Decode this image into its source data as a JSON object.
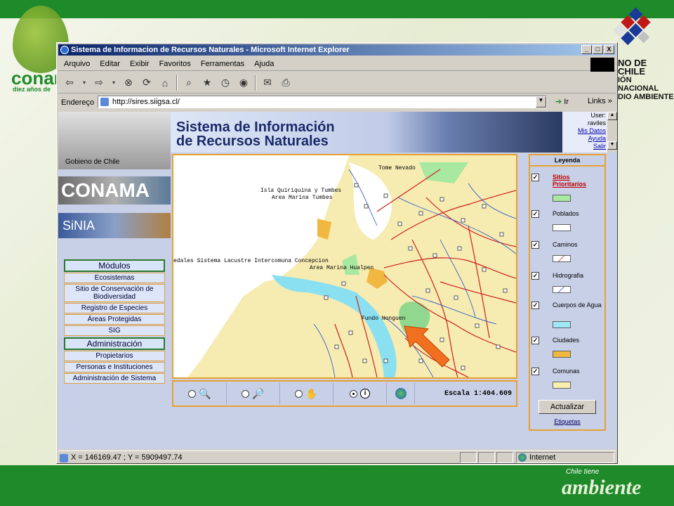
{
  "slide": {
    "conama_logo": "conam",
    "conama_sub": "diez años de",
    "gov_line1": "NO DE CHILE",
    "gov_line2": "IÓN NACIONAL",
    "gov_line3": "DIO AMBIENTE",
    "chile_tiene": "Chile tiene",
    "ambiente": "ambiente"
  },
  "window": {
    "title": "Sistema de Informacion de Recursos Naturales - Microsoft Internet Explorer",
    "controls": [
      "_",
      "□",
      "X"
    ]
  },
  "menu": [
    "Arquivo",
    "Editar",
    "Exibir",
    "Favoritos",
    "Ferramentas",
    "Ajuda"
  ],
  "toolbar_icons": [
    "back-icon",
    "forward-icon",
    "stop-icon",
    "refresh-icon",
    "home-icon",
    "search-icon",
    "favorites-icon",
    "history-icon",
    "mail-icon",
    "print-icon"
  ],
  "address": {
    "label": "Endereço",
    "url": "http://sires.siigsa.cl/",
    "go": "Ir",
    "links": "Links"
  },
  "header": {
    "gobierno": "Gobieno de Chile",
    "title_line1": "Sistema de Información",
    "title_line2": "de Recursos Naturales",
    "user_label": "User:",
    "user_name": "raviles",
    "links": [
      "Mis Datos",
      "Ayuda",
      "Salir"
    ]
  },
  "banners": {
    "conama": "CONAMA",
    "sinia": "SiNIA"
  },
  "modules": {
    "head1": "Módulos",
    "items1": [
      "Ecosistemas",
      "Sitio de Conservación de Biodiversidad",
      "Registro de Especies",
      "Áreas Protegidas",
      "SIG"
    ],
    "head2": "Administración",
    "items2": [
      "Propietarios",
      "Personas e Instituciones",
      "Administración de Sistema"
    ]
  },
  "map_labels": {
    "tome": "Tome Nevado",
    "quiriquina": "Isla Quiriquina y Tumbes",
    "marina": "Area Marina Tumbes",
    "humedales": "edales Sistema Lacustre Intercomuna Concepcion",
    "hualpen": "Area Marina Hualpen",
    "nonguen": "Fundo Nonguen"
  },
  "map_tools": {
    "escala": "Escala 1:404.609"
  },
  "legend": {
    "title": "Leyenda",
    "items": [
      {
        "label": "Sitios Prioritarios",
        "color": "#a8e8a0"
      },
      {
        "label": "Poblados",
        "color": "#ffffff"
      },
      {
        "label": "Caminos",
        "color": "#ffffff"
      },
      {
        "label": "Hidrografia",
        "color": "#ffffff"
      },
      {
        "label": "Cuerpos de Agua",
        "color": "#a0e8f8"
      },
      {
        "label": "Ciudades",
        "color": "#f0b840"
      },
      {
        "label": "Comunas",
        "color": "#f8f0b0"
      }
    ],
    "update_button": "Actualizar",
    "etiquetas": "Etiquetas"
  },
  "status": {
    "coords": "X = 146169.47 ; Y = 5909497.74",
    "zone": "Internet"
  }
}
